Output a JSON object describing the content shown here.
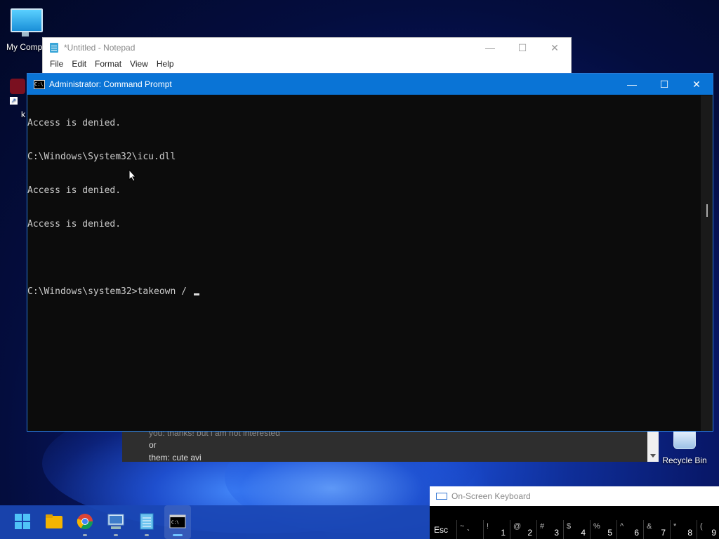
{
  "desktop": {
    "icons": [
      {
        "name": "my-computer",
        "label": "My Compu"
      },
      {
        "name": "recycle-bin",
        "label": "Recycle Bin"
      },
      {
        "name": "shortcut",
        "label": "k"
      }
    ]
  },
  "notepad": {
    "title": "*Untitled - Notepad",
    "menu": [
      "File",
      "Edit",
      "Format",
      "View",
      "Help"
    ]
  },
  "cmd": {
    "title": "Administrator: Command Prompt",
    "lines": [
      "Access is denied.",
      "C:\\Windows\\System32\\icu.dll",
      "Access is denied.",
      "Access is denied.",
      "",
      "C:\\Windows\\system32>takeown / "
    ]
  },
  "chat": {
    "lines": [
      "you: thanks! but i am not interested",
      "or",
      "them: cute avi"
    ]
  },
  "taskbar": {
    "apps": [
      "start-icon",
      "file-explorer-icon",
      "chrome-icon",
      "control-panel-icon",
      "notepad-icon",
      "command-prompt-icon"
    ]
  },
  "osk": {
    "title": "On-Screen Keyboard",
    "keys": [
      {
        "shift": "",
        "base": "Esc"
      },
      {
        "shift": "~",
        "base": "`"
      },
      {
        "shift": "!",
        "base": "1"
      },
      {
        "shift": "@",
        "base": "2"
      },
      {
        "shift": "#",
        "base": "3"
      },
      {
        "shift": "$",
        "base": "4"
      },
      {
        "shift": "%",
        "base": "5"
      },
      {
        "shift": "^",
        "base": "6"
      },
      {
        "shift": "&",
        "base": "7"
      },
      {
        "shift": "*",
        "base": "8"
      },
      {
        "shift": "(",
        "base": "9"
      }
    ]
  }
}
